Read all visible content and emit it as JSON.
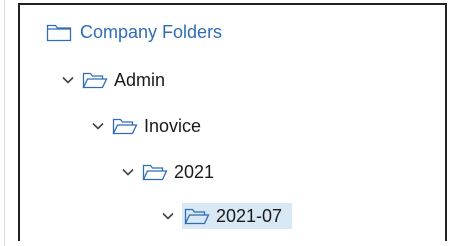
{
  "tree": {
    "root": {
      "label": "Company Folders",
      "icon": "folder-closed-icon"
    },
    "nodes": [
      {
        "label": "Admin",
        "expanded": true,
        "icon": "folder-open-icon"
      },
      {
        "label": "Inovice",
        "expanded": true,
        "icon": "folder-open-icon"
      },
      {
        "label": "2021",
        "expanded": true,
        "icon": "folder-open-icon"
      },
      {
        "label": "2021-07",
        "expanded": true,
        "selected": true,
        "icon": "folder-open-icon"
      }
    ]
  },
  "colors": {
    "accent": "#2f6db5",
    "selection": "#d9e8f5",
    "text": "#1a1a1a",
    "border": "#222222"
  }
}
